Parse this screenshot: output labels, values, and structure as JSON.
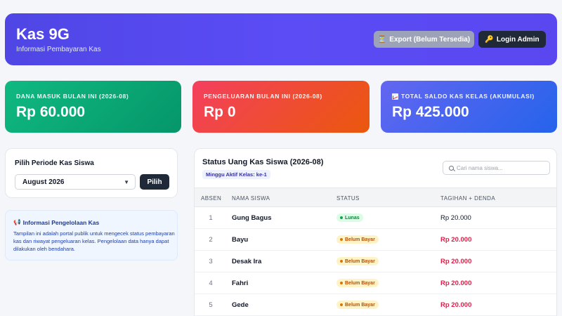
{
  "header": {
    "title": "Kas 9G",
    "subtitle": "Informasi Pembayaran Kas",
    "export_icon": "hourglass-icon",
    "export_label": "Export (Belum Tersedia)",
    "login_icon": "key-icon",
    "login_label": "Login Admin"
  },
  "stats": [
    {
      "label": "DANA MASUK BULAN INI (2026-08)",
      "value": "Rp 60.000"
    },
    {
      "label": "PENGELUARAN BULAN INI (2026-08)",
      "value": "Rp 0"
    },
    {
      "label": "TOTAL SALDO KAS KELAS (AKUMULASI)",
      "value": "Rp 425.000",
      "icon": "chart-icon"
    }
  ],
  "period": {
    "title": "Pilih Periode Kas Siswa",
    "selected": "August 2026",
    "button": "Pilih"
  },
  "info": {
    "icon": "megaphone-icon",
    "title": "Informasi Pengelolaan Kas",
    "body": "Tampilan ini adalah portal publik untuk mengecek status pembayaran kas dan riwayat pengeluaran kelas. Pengelolaan data hanya dapat dilakukan oleh bendahara."
  },
  "table": {
    "title": "Status Uang Kas Siswa (2026-08)",
    "badge": "Minggu Aktif Kelas: ke-1",
    "search_placeholder": "Cari nama siswa...",
    "columns": [
      "ABSEN",
      "NAMA SISWA",
      "STATUS",
      "TAGIHAN + DENDA"
    ],
    "rows": [
      {
        "absen": "1",
        "nama": "Gung Bagus",
        "status": "Lunas",
        "tagihan": "Rp 20.000"
      },
      {
        "absen": "2",
        "nama": "Bayu",
        "status": "Belum Bayar",
        "tagihan": "Rp 20.000"
      },
      {
        "absen": "3",
        "nama": "Desak Ira",
        "status": "Belum Bayar",
        "tagihan": "Rp 20.000"
      },
      {
        "absen": "4",
        "nama": "Fahri",
        "status": "Belum Bayar",
        "tagihan": "Rp 20.000"
      },
      {
        "absen": "5",
        "nama": "Gede",
        "status": "Belum Bayar",
        "tagihan": "Rp 20.000"
      }
    ]
  },
  "colors": {
    "header": "#5b4cf5",
    "income": "#10b981",
    "expense": "#f43f5e",
    "balance": "#4f5ef0",
    "paid": "#15803d",
    "unpaid": "#b45309",
    "due": "#e11d48"
  }
}
